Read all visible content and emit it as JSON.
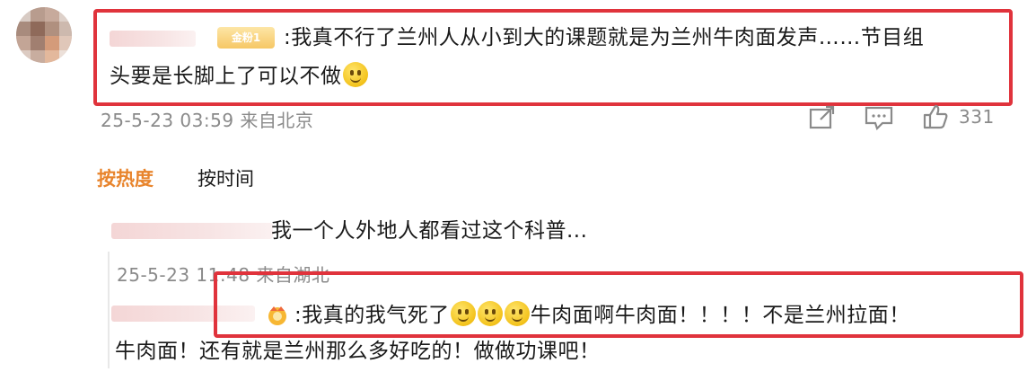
{
  "comment1": {
    "badge": "金粉1",
    "text_line1": ":我真不行了兰州人从小到大的课题就是为兰州牛肉面发声……节目组",
    "text_line2": "头要是长脚上了可以不做",
    "meta": "25-5-23 03:59 来自北京",
    "like_count": "331",
    "icons": [
      "share-icon",
      "comment-icon",
      "like-icon"
    ]
  },
  "tabs": {
    "hot": "按热度",
    "time": "按时间"
  },
  "reply1": {
    "text": "我一个人外地人都看过这个科普...",
    "meta": "25-5-23 11:48 来自湖北"
  },
  "reply2": {
    "text_part1": ":我真的我气死了",
    "text_part2": "牛肉面啊牛肉面！！！！不是兰州拉面！",
    "text_line2": "牛肉面！还有就是兰州那么多好吃的！做做功课吧！"
  },
  "colors": {
    "highlight_box": "#e0333c",
    "hot_tab": "#e8842c",
    "meta_text": "#8a8a8a"
  }
}
